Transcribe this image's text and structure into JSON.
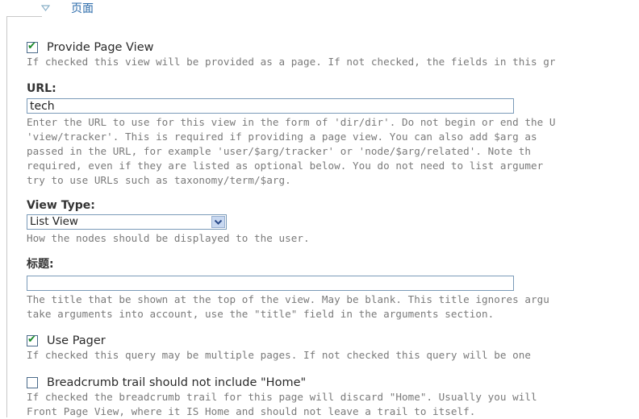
{
  "fieldset": {
    "legend_title": "页面",
    "toggle_icon": "triangle-down"
  },
  "provide_page_view": {
    "checked": true,
    "label": "Provide Page View",
    "description": "If checked this view will be provided as a page. If not checked, the fields in this gr"
  },
  "url": {
    "label": "URL:",
    "value": "tech",
    "description": [
      "Enter the URL to use for this view in the form of 'dir/dir'. Do not begin or end the U",
      "'view/tracker'. This is required if providing a page view. You can also add $arg as",
      "passed in the URL, for example 'user/$arg/tracker' or 'node/$arg/related'. Note th",
      "required, even if they are listed as optional below. You do not need to list argumer",
      "try to use URLs such as taxonomy/term/$arg."
    ]
  },
  "view_type": {
    "label": "View Type:",
    "selected": "List View",
    "description": "How the nodes should be displayed to the user."
  },
  "title": {
    "label": "标题:",
    "value": "",
    "description": [
      "The title that be shown at the top of the view. May be blank. This title ignores argu",
      "take arguments into account, use the \"title\" field in the arguments section."
    ]
  },
  "use_pager": {
    "checked": true,
    "label": "Use Pager",
    "description": "If checked this query may be multiple pages. If not checked this query will be one"
  },
  "breadcrumb": {
    "checked": false,
    "label": "Breadcrumb trail should not include \"Home\"",
    "description": [
      "If checked the breadcrumb trail for this page will discard \"Home\". Usually you will",
      "Front Page View, where it IS Home and should not leave a trail to itself."
    ]
  },
  "colors": {
    "legend": "#2a6aaa",
    "checkmark": "#1a8a2a",
    "description_text": "#7a7a7a",
    "input_border": "#7a9ab8"
  }
}
